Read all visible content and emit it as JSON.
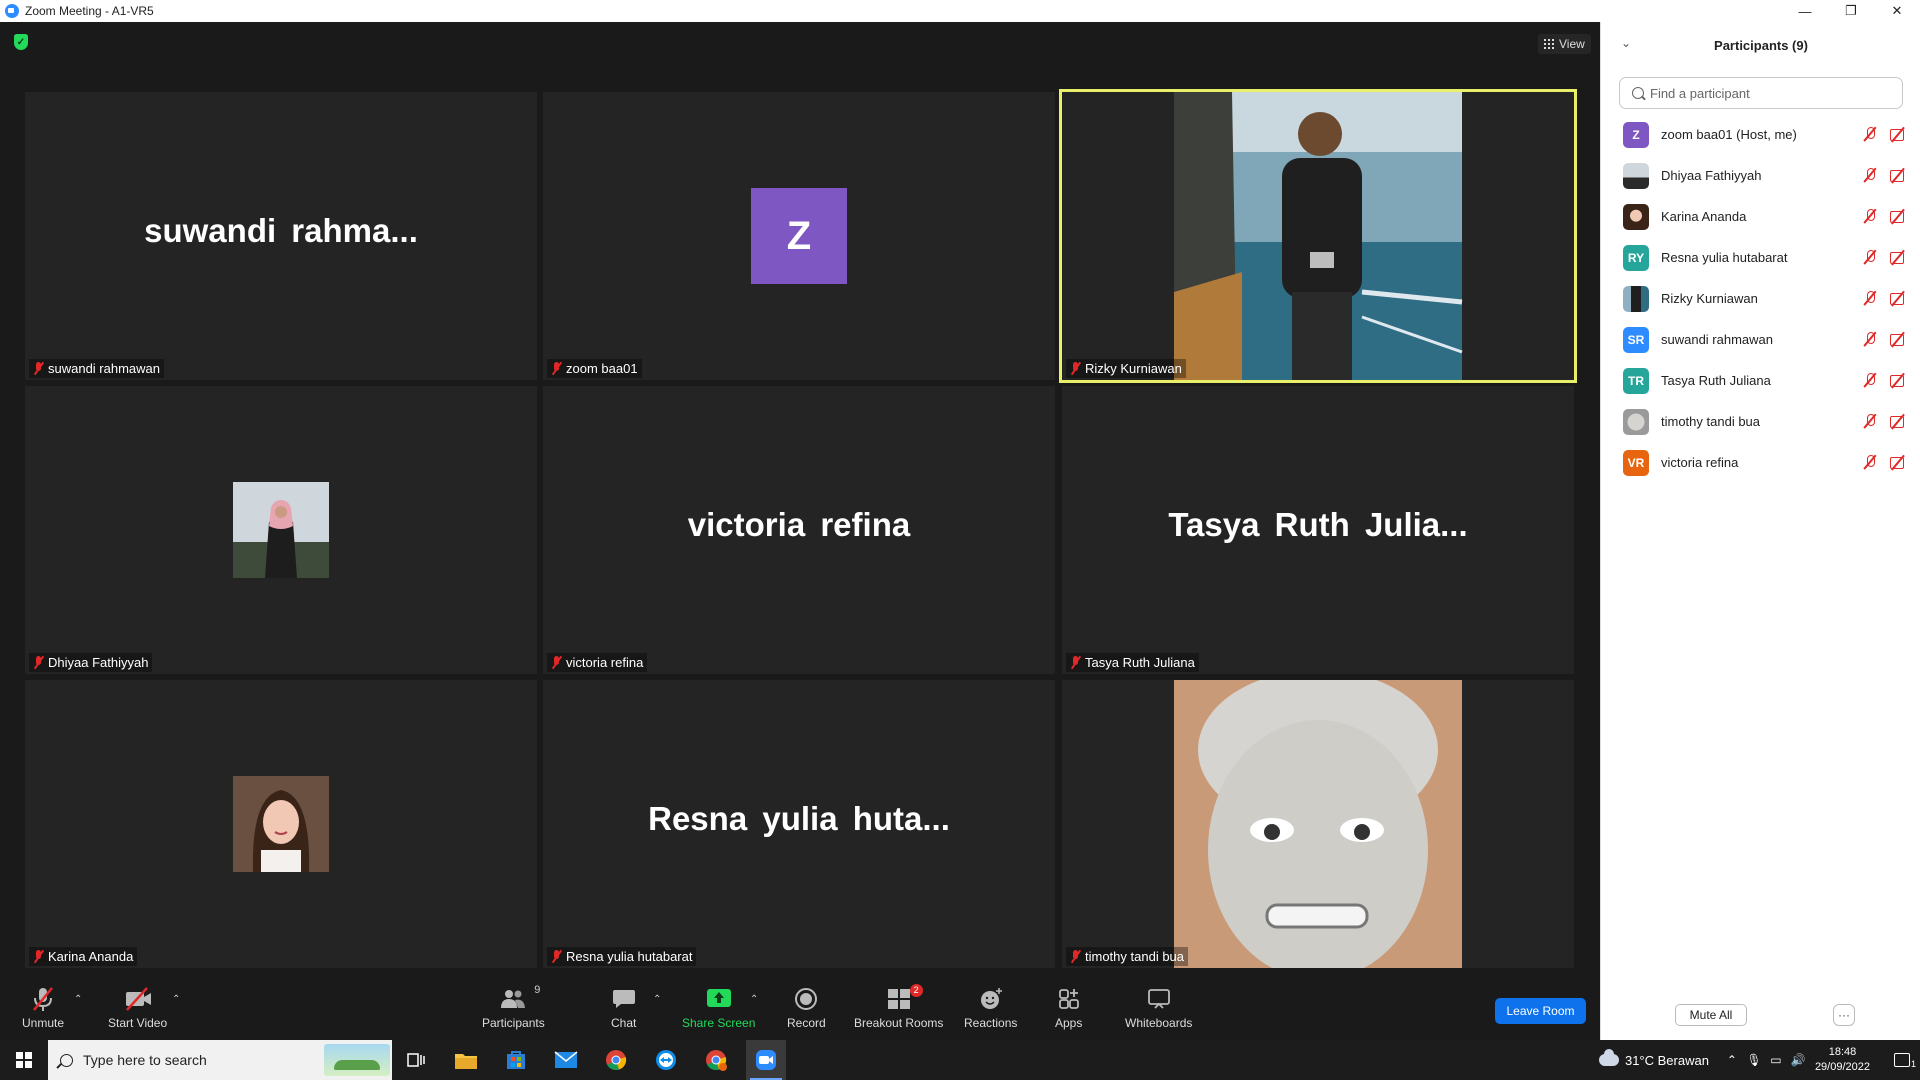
{
  "window": {
    "title": "Zoom Meeting - A1-VR5"
  },
  "meeting": {
    "view_label": "View",
    "tiles": [
      {
        "display": "name",
        "big_name": "suwandi  rahma...",
        "label": "suwandi rahmawan"
      },
      {
        "display": "avatar",
        "initial": "Z",
        "label": "zoom baa01"
      },
      {
        "display": "video",
        "label": "Rizky Kurniawan",
        "active": true
      },
      {
        "display": "photo",
        "label": "Dhiyaa Fathiyyah"
      },
      {
        "display": "name",
        "big_name": "victoria refina",
        "label": "victoria refina"
      },
      {
        "display": "name",
        "big_name": "Tasya  Ruth  Julia...",
        "label": "Tasya Ruth Juliana"
      },
      {
        "display": "photo",
        "label": "Karina Ananda"
      },
      {
        "display": "name",
        "big_name": "Resna  yulia  huta...",
        "label": "Resna yulia hutabarat"
      },
      {
        "display": "video",
        "label": "timothy tandi bua"
      }
    ]
  },
  "toolbar": {
    "unmute": "Unmute",
    "start_video": "Start Video",
    "participants": "Participants",
    "participants_count": "9",
    "chat": "Chat",
    "share_screen": "Share Screen",
    "record": "Record",
    "breakout_rooms": "Breakout Rooms",
    "breakout_badge": "2",
    "reactions": "Reactions",
    "apps": "Apps",
    "whiteboards": "Whiteboards",
    "leave_room": "Leave Room"
  },
  "panel": {
    "title": "Participants (9)",
    "search_placeholder": "Find a participant",
    "mute_all": "Mute All",
    "more": "···",
    "participants": [
      {
        "initials": "Z",
        "name": "zoom baa01 (Host, me)",
        "color": "#7e57c2",
        "type": "initials"
      },
      {
        "initials": "",
        "name": "Dhiyaa Fathiyyah",
        "color": "#6b7a8a",
        "type": "photo"
      },
      {
        "initials": "",
        "name": "Karina Ananda",
        "color": "#b08a7a",
        "type": "photo"
      },
      {
        "initials": "RY",
        "name": "Resna yulia hutabarat",
        "color": "#26a69a",
        "type": "initials"
      },
      {
        "initials": "",
        "name": "Rizky Kurniawan",
        "color": "#4a5a50",
        "type": "photo"
      },
      {
        "initials": "SR",
        "name": "suwandi rahmawan",
        "color": "#2d8cff",
        "type": "initials"
      },
      {
        "initials": "TR",
        "name": "Tasya Ruth Juliana",
        "color": "#26a69a",
        "type": "initials"
      },
      {
        "initials": "",
        "name": "timothy tandi bua",
        "color": "#9a9a9a",
        "type": "photo"
      },
      {
        "initials": "VR",
        "name": "victoria refina",
        "color": "#e8650f",
        "type": "initials"
      }
    ]
  },
  "taskbar": {
    "search_placeholder": "Type here to search",
    "weather": "31°C  Berawan",
    "time": "18:48",
    "date": "29/09/2022",
    "notification_count": "1"
  },
  "colors": {
    "accent_blue": "#0e72ed",
    "muted_red": "#e02828",
    "share_green": "#23d959",
    "active_speaker": "#e8f06a"
  }
}
